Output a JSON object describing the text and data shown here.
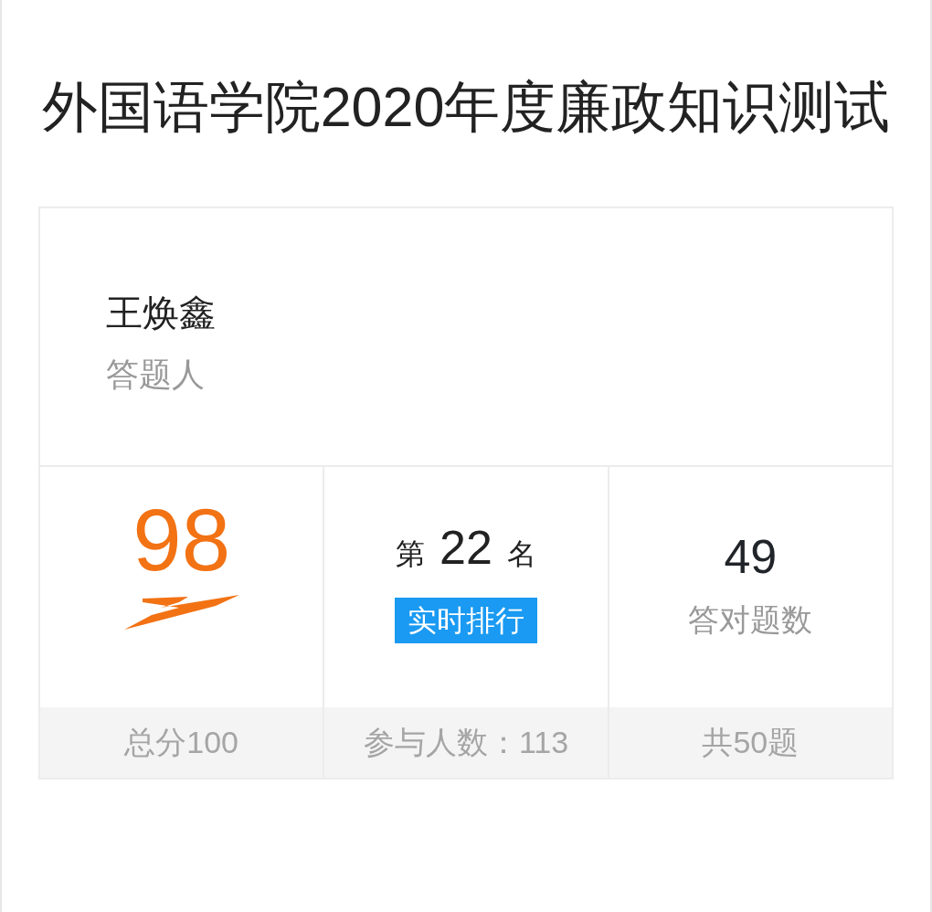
{
  "title": "外国语学院2020年度廉政知识测试",
  "respondent": {
    "name": "王焕鑫",
    "label": "答题人"
  },
  "stats": [
    {
      "kind": "score",
      "value": "98",
      "footer": "总分100"
    },
    {
      "kind": "rank",
      "prefix": "第",
      "value": "22",
      "suffix": "名",
      "button": "实时排行",
      "footer": "参与人数：113"
    },
    {
      "kind": "count",
      "value": "49",
      "caption": "答对题数",
      "footer": "共50题"
    }
  ]
}
